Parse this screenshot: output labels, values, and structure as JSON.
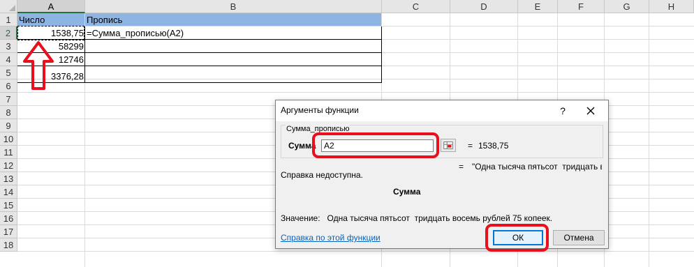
{
  "columns": [
    "A",
    "B",
    "C",
    "D",
    "E",
    "F",
    "G",
    "H"
  ],
  "rows": [
    "1",
    "2",
    "3",
    "4",
    "5",
    "6",
    "7",
    "8",
    "9",
    "10",
    "11",
    "12",
    "13",
    "14",
    "15",
    "16",
    "17",
    "18"
  ],
  "table": {
    "header_a": "Число",
    "header_b": "Пропись",
    "a_values": [
      "1538,75",
      "58299",
      "12746",
      "3376,28"
    ],
    "b2_formula": "=Сумма_прописью(A2)"
  },
  "dialog": {
    "title": "Аргументы функции",
    "help_glyph": "?",
    "function_name": "Сумма_прописью",
    "arg_label": "Сумма",
    "arg_input_value": "A2",
    "eq": "=",
    "arg_value": "1538,75",
    "result_preview": "\"Одна тысяча пятьсот  тридцать во",
    "help_unavailable": "Справка недоступна.",
    "arg_name_bold": "Сумма",
    "value_line": "Значение:   Одна тысяча пятьсот  тридцать восемь рублей 75 копеек.",
    "help_link": "Справка по этой функции",
    "ok_label": "ОК",
    "cancel_label": "Отмена"
  },
  "colors": {
    "header_fill": "#8db4e2",
    "highlight_red": "#e8101c",
    "selection_green": "#217346",
    "link_blue": "#0563c1",
    "ok_border": "#0078d7"
  },
  "icons": {
    "arrow": "red-up-arrow-outline",
    "collapse": "range-collapse-icon",
    "close": "close-x-icon"
  }
}
